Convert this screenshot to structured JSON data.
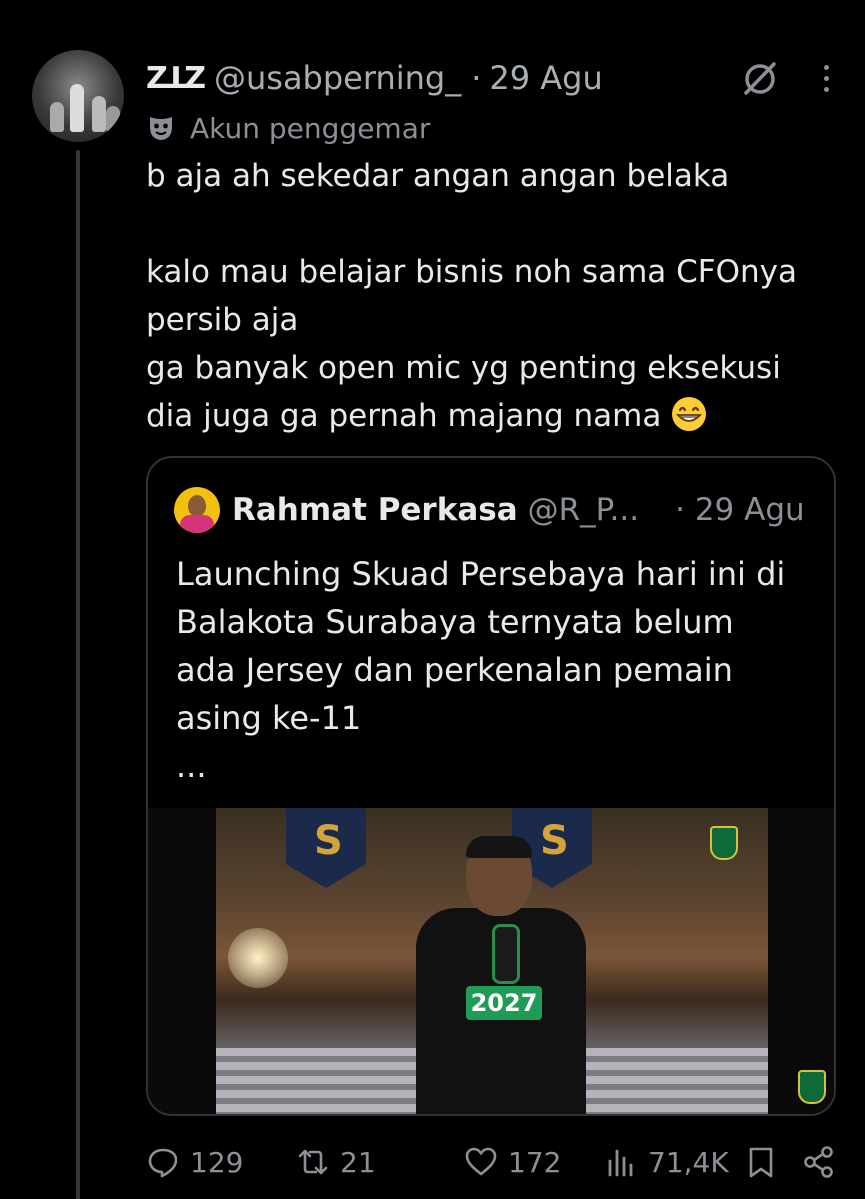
{
  "tweet": {
    "handle_prefix": "ZꓕZ",
    "handle": "@usabperning_",
    "separator": "·",
    "date": "29 Agu",
    "label": "Akun penggemar",
    "text_lines": [
      "b aja ah sekedar angan angan belaka",
      "",
      "kalo mau belajar bisnis noh sama CFOnya",
      "persib aja",
      "ga banyak open mic yg penting eksekusi",
      "dia juga ga pernah majang nama"
    ],
    "emoji": "grinning-face-with-smiling-eyes"
  },
  "quote": {
    "name": "Rahmat Perkasa",
    "handle": "@R_P...",
    "separator": "·",
    "date": "29 Agu",
    "text_lines": [
      "Launching Skuad Persebaya hari ini di",
      "Balakota Surabaya ternyata belum",
      "ada Jersey dan perkenalan pemain",
      "asing ke-11",
      "..."
    ],
    "media_text": "2027"
  },
  "actions": {
    "replies": "129",
    "reposts": "21",
    "likes": "172",
    "views": "71,4K"
  }
}
